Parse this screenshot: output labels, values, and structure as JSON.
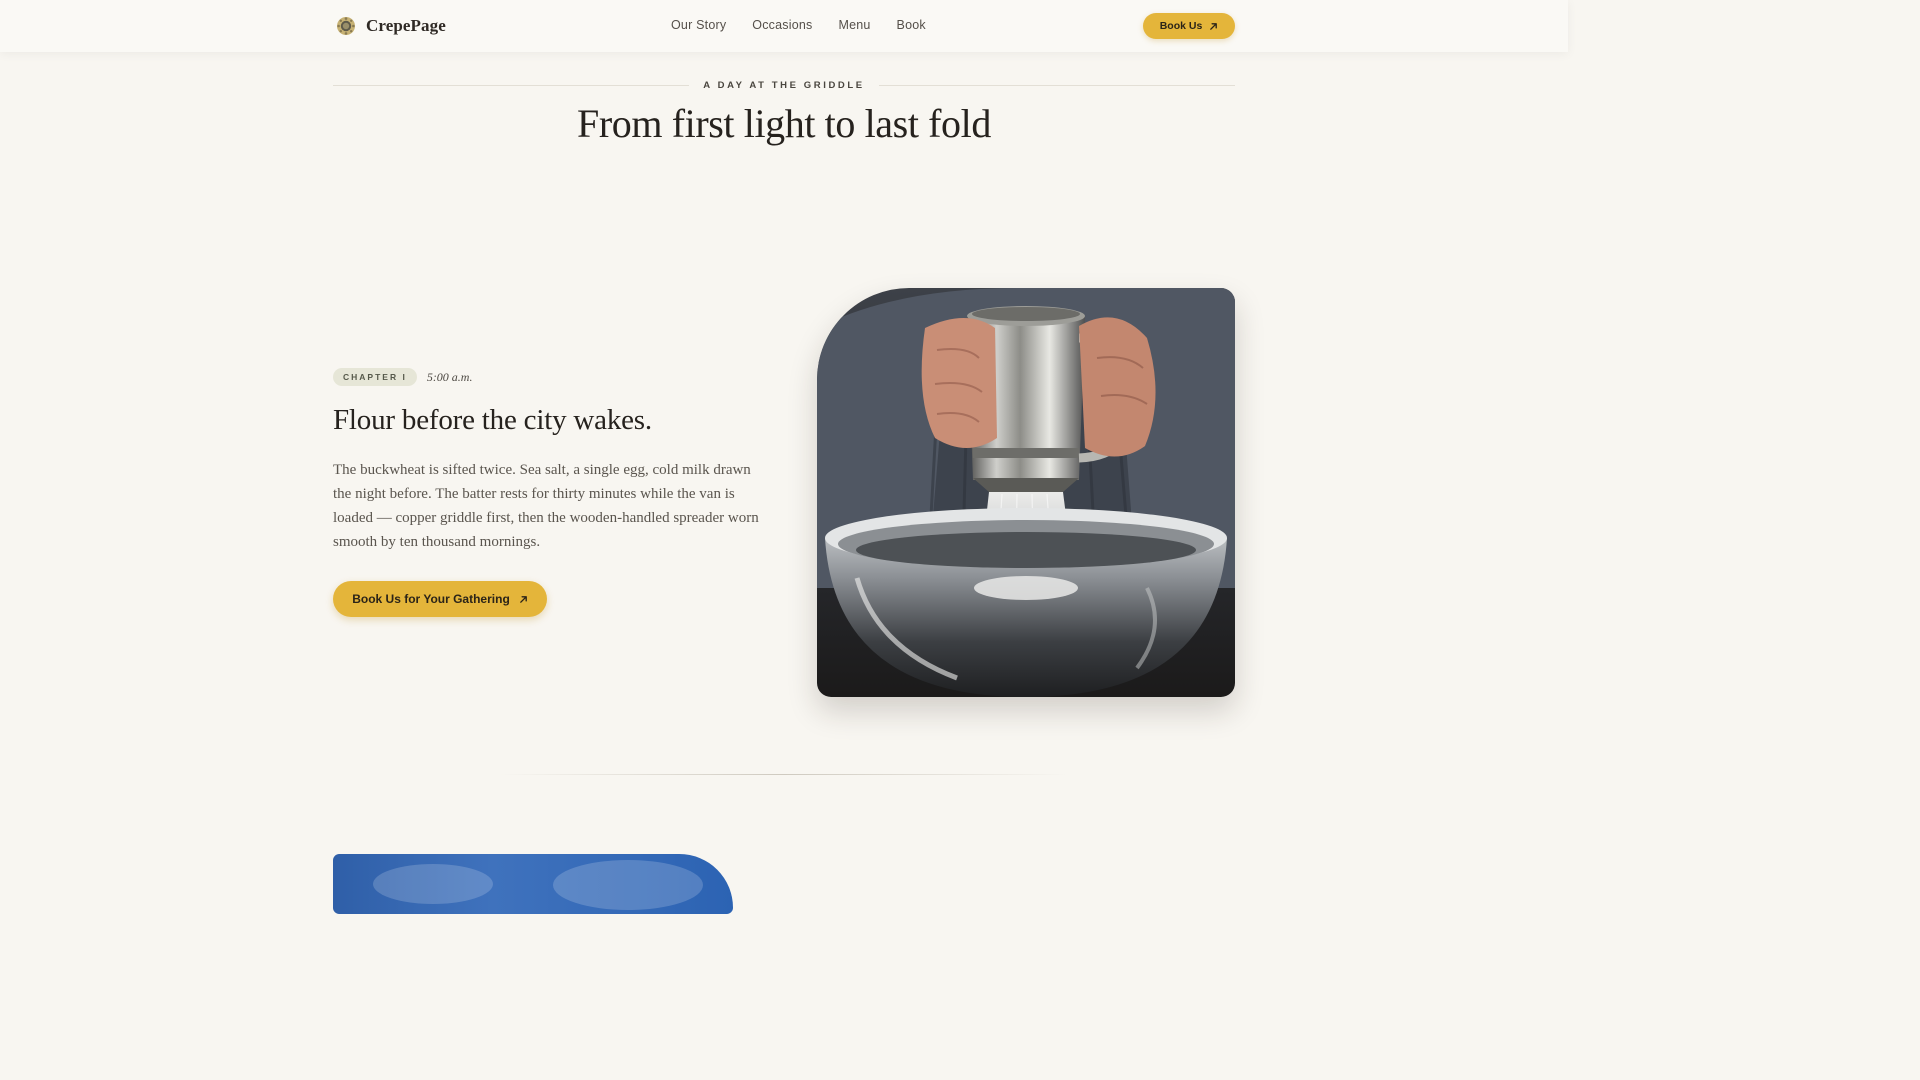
{
  "header": {
    "brand_name": "CrepePage",
    "logo_icon": "sunflower-crepe-icon",
    "nav": [
      "Our Story",
      "Occasions",
      "Menu",
      "Book"
    ],
    "cta_label": "Book Us",
    "cta_icon": "arrow-up-right-icon"
  },
  "section": {
    "eyebrow": "A DAY AT THE GRIDDLE",
    "title": "From first light to last fold"
  },
  "chapter": {
    "badge": "CHAPTER I",
    "time": "5:00 a.m.",
    "heading": "Flour before the city wakes.",
    "body": "The buckwheat is sifted twice. Sea salt, a single egg, cold milk drawn the night before. The batter rests for thirty minutes while the van is loaded — copper griddle first, then the wooden-handled spreader worn smooth by ten thousand mornings.",
    "cta_label": "Book Us for Your Gathering",
    "cta_icon": "arrow-up-right-icon"
  },
  "colors": {
    "background": "#f8f6f1",
    "accent": "#e4b53a",
    "badge_bg": "#e6e6d7",
    "text_dark": "#26221e"
  }
}
